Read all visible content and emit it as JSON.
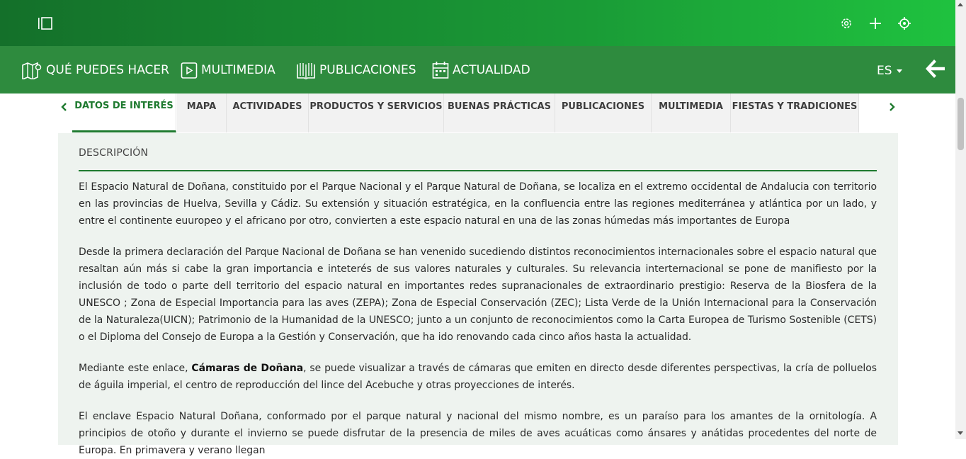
{
  "topbar": {
    "icons": [
      "sidebar-toggle-icon",
      "settings-icon",
      "plus-icon",
      "crosshair-icon"
    ]
  },
  "nav": {
    "items": [
      {
        "label": "QUÉ PUEDES HACER",
        "icon": "map-icon"
      },
      {
        "label": "MULTIMEDIA",
        "icon": "play-icon"
      },
      {
        "label": "PUBLICACIONES",
        "icon": "book-icon"
      },
      {
        "label": "ACTUALIDAD",
        "icon": "calendar-icon"
      }
    ],
    "language": "ES",
    "back_icon": "back-arrow-icon"
  },
  "tabs": {
    "items": [
      {
        "label": "DATOS DE INTERÉS",
        "active": true
      },
      {
        "label": "MAPA"
      },
      {
        "label": "ACTIVIDADES"
      },
      {
        "label": "PRODUCTOS Y SERVICIOS"
      },
      {
        "label": "BUENAS PRÁCTICAS"
      },
      {
        "label": "PUBLICACIONES"
      },
      {
        "label": "MULTIMEDIA"
      },
      {
        "label": "FIESTAS Y TRADICIONES"
      }
    ]
  },
  "content": {
    "section_title": "DESCRIPCIÓN",
    "p1": "El Espacio Natural de Doñana, constituido por el Parque Nacional y el Parque Natural de Doñana, se localiza en el extremo occidental de Andalucia con territorio en las provincias de Huelva, Sevilla y Cádiz. Su extensión y situación estratégica, en la confluencia entre las regiones mediterránea y atlántica por un lado, y entre el continente euuropeo y el africano por otro, convierten a este espacio natural en una de las zonas húmedas más importantes de Europa",
    "p2": "Desde la primera declaración del Parque Nacional de Doñana se han venenido sucediendo distintos reconocimientos internacionales sobre el espacio natural que resaltan aún más si cabe la gran importancia e inteterés de sus valores naturales y culturales. Su relevancia interternacional se pone de manifiesto por la inclusión de todo o parte dell territorio del espacio natural en importantes redes supranacionales de extraordinario prestigio: Reserva de la Biosfera de la UNESCO ; Zona de Especial Importancia para las aves (ZEPA); Zona de Especial Conservación (ZEC); Lista Verde de la Unión Internacional para la Conservación de la Naturaleza(UICN); Patrimonio de la Humanidad de la UNESCO; junto a un conjunto de reconocimientos como la Carta Europea de Turismo Sostenible (CETS) o el Diploma del Consejo de Europa a la Gestión y Conservación, que ha ido renovando cada cinco años hasta la actualidad.",
    "p3_before": "Mediante este enlace, ",
    "p3_link": "Cámaras de Doñana",
    "p3_after": ", se puede visualizar a través de cámaras que emiten en directo desde diferentes perspectivas, la cría de polluelos de águila imperial, el centro de reproducción del lince del Acebuche y otras proyecciones de interés.",
    "p4": "El enclave Espacio Natural Doñana, conformado por el parque natural y nacional del mismo nombre, es un paraíso para los amantes de la ornitología. A principios de otoño y durante el invierno se puede disfrutar de la presencia de miles de aves acuáticas como ánsares y anátidas procedentes del norte de Europa. En primavera y verano llegan"
  }
}
